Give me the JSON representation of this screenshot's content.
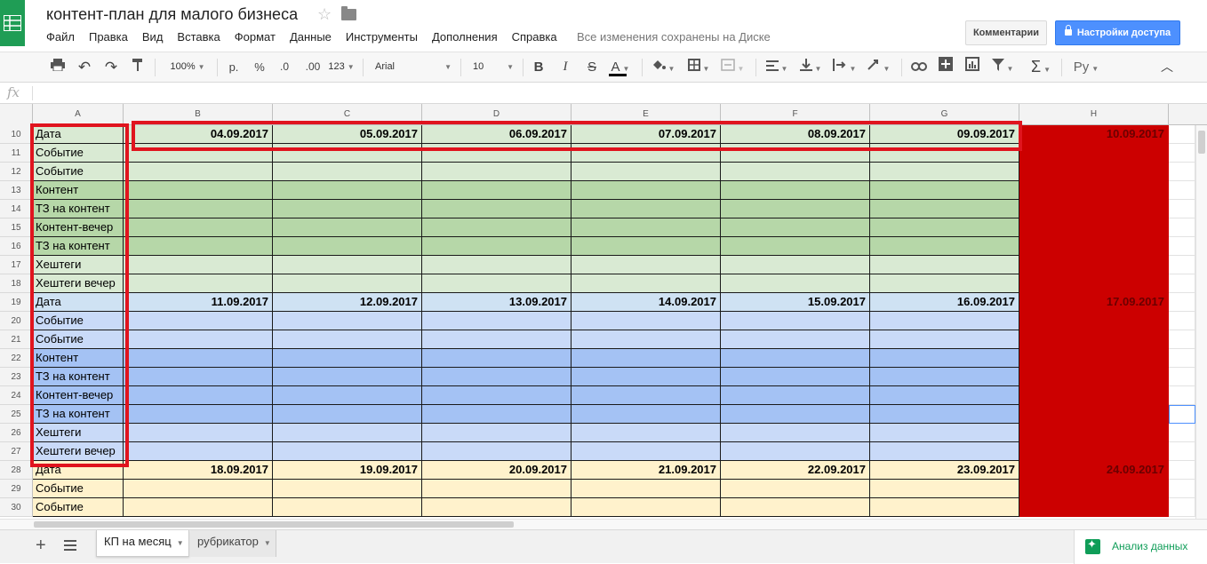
{
  "app": {
    "doc_title": "контент-план для малого бизнеса",
    "menu": [
      "Файл",
      "Правка",
      "Вид",
      "Вставка",
      "Формат",
      "Данные",
      "Инструменты",
      "Дополнения",
      "Справка"
    ],
    "save_status": "Все изменения сохранены на Диске",
    "comments_label": "Комментарии",
    "access_label": "Настройки доступа"
  },
  "toolbar": {
    "zoom": "100%",
    "currency": "р.",
    "percent": "%",
    "decimal_less": ".0",
    "decimal_more": ".00",
    "more_formats": "123",
    "font": "Arial",
    "font_size": "10",
    "bold": "B",
    "italic": "I",
    "strike": "S",
    "text_color": "A",
    "input_lang": "Ру"
  },
  "formula_bar": {
    "fx": "fx",
    "value": ""
  },
  "grid": {
    "columns": [
      "A",
      "B",
      "C",
      "D",
      "E",
      "F",
      "G",
      "H"
    ],
    "rows": [
      {
        "num": "10",
        "label": "Дата",
        "dates": [
          "04.09.2017",
          "05.09.2017",
          "06.09.2017",
          "07.09.2017",
          "08.09.2017",
          "09.09.2017"
        ],
        "red": "10.09.2017",
        "style": "green-date"
      },
      {
        "num": "11",
        "label": "Событие",
        "style": "green-light"
      },
      {
        "num": "12",
        "label": "Событие",
        "style": "green-light"
      },
      {
        "num": "13",
        "label": "Контент",
        "style": "green-dark"
      },
      {
        "num": "14",
        "label": "ТЗ на контент",
        "style": "green-dark"
      },
      {
        "num": "15",
        "label": "Контент-вечер",
        "style": "green-dark"
      },
      {
        "num": "16",
        "label": "ТЗ на контент",
        "style": "green-dark"
      },
      {
        "num": "17",
        "label": "Хештеги",
        "style": "green-light"
      },
      {
        "num": "18",
        "label": "Хештеги вечер",
        "style": "green-light"
      },
      {
        "num": "19",
        "label": "Дата",
        "dates": [
          "11.09.2017",
          "12.09.2017",
          "13.09.2017",
          "14.09.2017",
          "15.09.2017",
          "16.09.2017"
        ],
        "red": "17.09.2017",
        "style": "blue-date"
      },
      {
        "num": "20",
        "label": "Событие",
        "style": "blue-light"
      },
      {
        "num": "21",
        "label": "Событие",
        "style": "blue-light"
      },
      {
        "num": "22",
        "label": "Контент",
        "style": "blue-dark"
      },
      {
        "num": "23",
        "label": "ТЗ на контент",
        "style": "blue-dark"
      },
      {
        "num": "24",
        "label": "Контент-вечер",
        "style": "blue-dark"
      },
      {
        "num": "25",
        "label": "ТЗ на контент",
        "style": "blue-dark"
      },
      {
        "num": "26",
        "label": "Хештеги",
        "style": "blue-light"
      },
      {
        "num": "27",
        "label": "Хештеги вечер",
        "style": "blue-light"
      },
      {
        "num": "28",
        "label": "Дата",
        "dates": [
          "18.09.2017",
          "19.09.2017",
          "20.09.2017",
          "21.09.2017",
          "22.09.2017",
          "23.09.2017"
        ],
        "red": "24.09.2017",
        "style": "yellow-date"
      },
      {
        "num": "29",
        "label": "Событие",
        "style": "yellow-light"
      },
      {
        "num": "30",
        "label": "Событие",
        "style": "yellow-light"
      }
    ],
    "colors": {
      "green-date": "#d9ead3",
      "green-light": "#d9ead3",
      "green-dark": "#b6d7a8",
      "blue-date": "#cfe2f3",
      "blue-light": "#c9daf8",
      "blue-dark": "#a4c2f4",
      "yellow-date": "#fff2cc",
      "yellow-light": "#fff2cc",
      "red": "#cc0000",
      "annotation": "#e0141e"
    }
  },
  "sheets": {
    "tabs": [
      "КП на месяц",
      "рубрикатор"
    ],
    "active": "КП на месяц",
    "explore_label": "Анализ данных"
  }
}
